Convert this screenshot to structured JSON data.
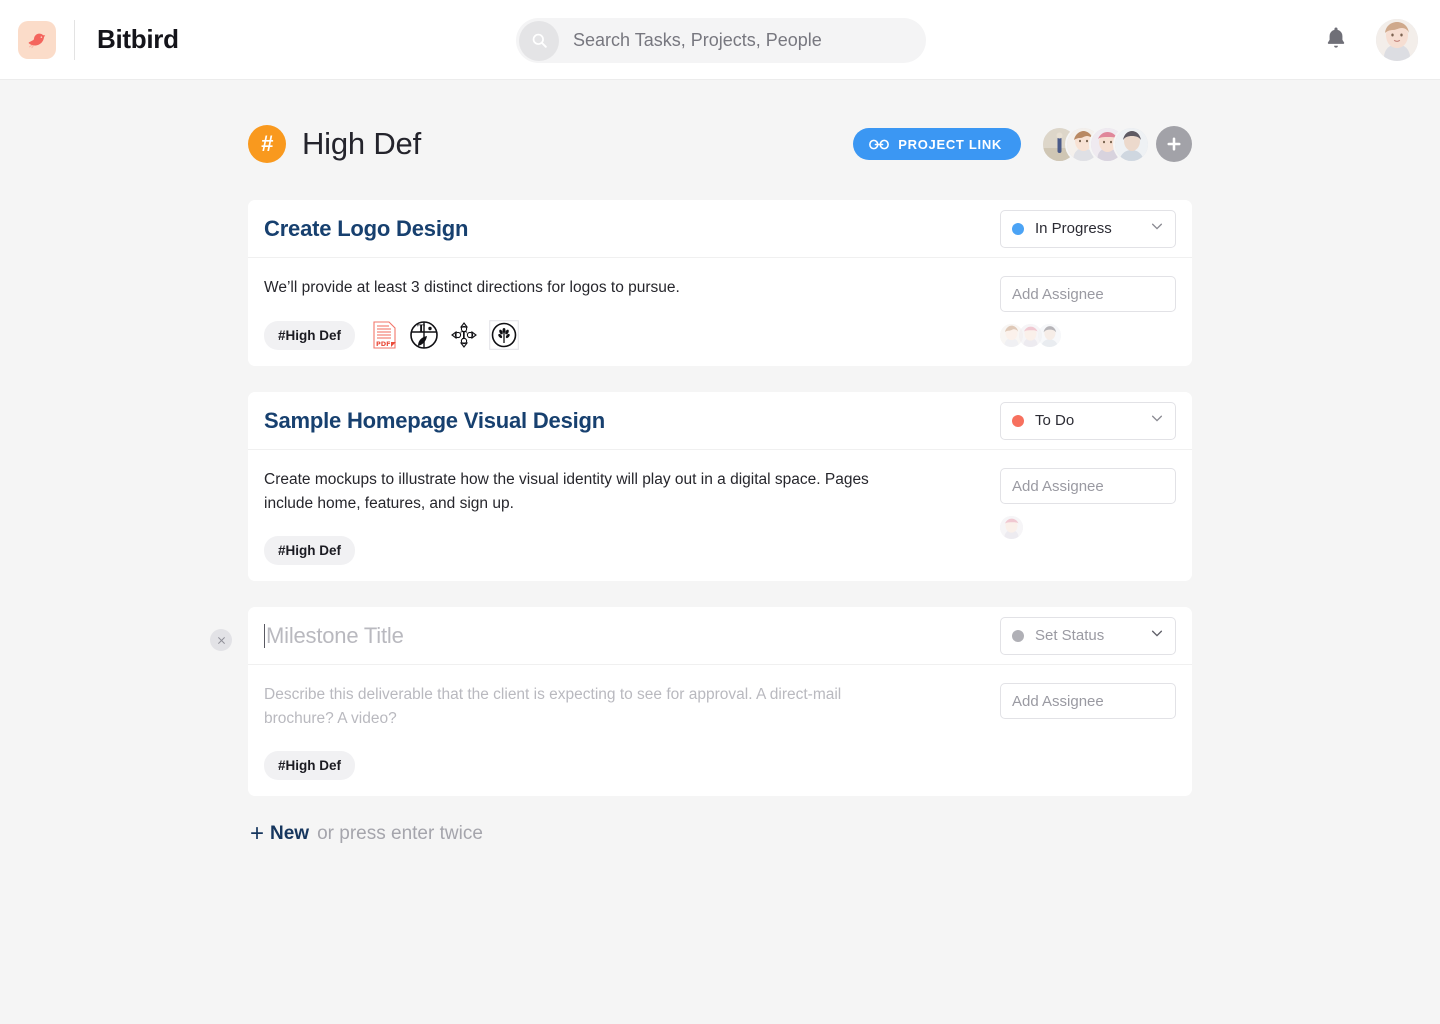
{
  "app": {
    "brand_name": "Bitbird",
    "logo_icon": "bird-logo-icon"
  },
  "search": {
    "placeholder": "Search Tasks, Projects, People",
    "value": "",
    "icon": "search-icon"
  },
  "topbar": {
    "notifications_icon": "bell-icon",
    "user_avatar": "user-avatar"
  },
  "project": {
    "badge_glyph": "#",
    "title": "High Def",
    "link_button_label": "PROJECT LINK",
    "link_button_icon": "chain-link-icon",
    "link_button_color": "#3b97f3",
    "badge_color": "#f9991e",
    "add_member_label": "+",
    "members_count": 4
  },
  "cards": [
    {
      "title": "Create Logo Design",
      "title_is_placeholder": false,
      "status": {
        "label": "In Progress",
        "color": "#4ba3f5"
      },
      "description": "We’ll provide at least 3 distinct directions for logos to pursue.",
      "description_is_placeholder": false,
      "tag": "#High Def",
      "attachments": [
        "pdf-file-icon",
        "logo-thumbnail-leaf-t",
        "logo-thumbnail-compass-t",
        "logo-thumbnail-wheat-circle"
      ],
      "assignee_placeholder": "Add Assignee",
      "assignee_value": "",
      "assignees_count": 3,
      "deletable": false
    },
    {
      "title": "Sample Homepage Visual Design",
      "title_is_placeholder": false,
      "status": {
        "label": "To Do",
        "color": "#f7705e"
      },
      "description": "Create mockups to illustrate how the visual identity will play out in a digital space. Pages include home, features, and sign up.",
      "description_is_placeholder": false,
      "tag": "#High Def",
      "attachments": [],
      "assignee_placeholder": "Add Assignee",
      "assignee_value": "",
      "assignees_count": 1,
      "deletable": false
    },
    {
      "title": "Milestone Title",
      "title_is_placeholder": true,
      "status": {
        "label": "Set Status",
        "color": "#b0b0b6"
      },
      "description": "Describe this deliverable that the client is expecting to see for approval. A direct-mail brochure? A video?",
      "description_is_placeholder": true,
      "tag": "#High Def",
      "attachments": [],
      "assignee_placeholder": "Add Assignee",
      "assignee_value": "",
      "assignees_count": 0,
      "deletable": true,
      "delete_icon": "close-icon"
    }
  ],
  "footer": {
    "new_plus": "+",
    "new_label": "New",
    "new_hint": "or press enter twice"
  }
}
